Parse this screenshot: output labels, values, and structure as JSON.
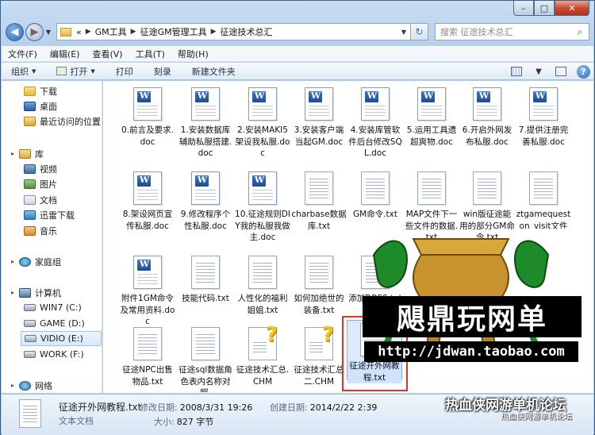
{
  "window": {
    "minimize": "–",
    "maximize": "□",
    "close": "✕"
  },
  "address": {
    "overflow": "«",
    "crumbs": [
      "GM工具",
      "征途GM管理工具",
      "征途技术总汇"
    ],
    "search_placeholder": "搜索 征途技术总汇"
  },
  "menu": [
    "文件(F)",
    "编辑(E)",
    "查看(V)",
    "工具(T)",
    "帮助(H)"
  ],
  "commands": {
    "organize": "组织",
    "open": "打开",
    "print": "打印",
    "burn": "刻录",
    "new_folder": "新建文件夹"
  },
  "nav": {
    "downloads": "下载",
    "desktop": "桌面",
    "recent": "最近访问的位置",
    "library": "库",
    "videos": "视频",
    "pictures": "图片",
    "documents": "文档",
    "thunder": "迅雷下载",
    "music": "音乐",
    "homegroup": "家庭组",
    "computer": "计算机",
    "drive_c": "WIN7 (C:)",
    "drive_d": "GAME (D:)",
    "drive_e": "VIDIO (E:)",
    "drive_f": "WORK (F:)",
    "network": "网络"
  },
  "files": [
    {
      "name": "0.前言及要求.doc",
      "type": "doc"
    },
    {
      "name": "1.安装数据库辅助私服搭建.doc",
      "type": "doc"
    },
    {
      "name": "2.安装MAKI5 架设我私服.doc",
      "type": "doc"
    },
    {
      "name": "3.安装客户端当起GM.doc",
      "type": "doc"
    },
    {
      "name": "4.安装库管软件后台修改SQL.doc",
      "type": "doc"
    },
    {
      "name": "5.运用工具遗超爽物.doc",
      "type": "doc"
    },
    {
      "name": "6.开启外网发布私服.doc",
      "type": "doc"
    },
    {
      "name": "7.提供注册完善私服.doc",
      "type": "doc"
    },
    {
      "name": "8.架设网页宣传私服.doc",
      "type": "doc"
    },
    {
      "name": "9.修改程序个性私服.doc",
      "type": "doc"
    },
    {
      "name": "10.征途规则DIY我的私服我做主.doc",
      "type": "doc"
    },
    {
      "name": "charbase数据库.txt",
      "type": "txt"
    },
    {
      "name": "GM命令.txt",
      "type": "txt"
    },
    {
      "name": "MAP文件下一些文件的数据.txt",
      "type": "txt"
    },
    {
      "name": "win版征途能用的部分GM命令.txt",
      "type": "txt"
    },
    {
      "name": "ztgamequeston_visit文件全部内容一览...",
      "type": "txt"
    },
    {
      "name": "附件1GM命令及常用资料.doc",
      "type": "doc"
    },
    {
      "name": "技能代码.txt",
      "type": "txt"
    },
    {
      "name": "人性化的福利姐姐.txt",
      "type": "txt"
    },
    {
      "name": "如何加绝世的装备.txt",
      "type": "txt"
    },
    {
      "name": "添加BOSS.txt",
      "type": "txt"
    },
    {
      "name": "征途NPC出售物品.txt",
      "type": "txt"
    },
    {
      "name": "征途sql数据角色表内名称对照.",
      "type": "txt"
    },
    {
      "name": "征途技术汇总.CHM",
      "type": "chm"
    },
    {
      "name": "征途技术汇总二.CHM",
      "type": "chm"
    },
    {
      "name": "征途开外网教程.txt",
      "type": "txt"
    }
  ],
  "watermark": {
    "title": "飓鼎玩网单",
    "url": "http://jdwan.taobao.com",
    "forum": "热血侠网游单机论坛",
    "forum_sub": "热血侠网游单机论坛"
  },
  "details": {
    "filename": "征途开外网教程.txt",
    "filetype": "文本文档",
    "modified_label": "修改日期:",
    "modified_value": "2008/3/31 19:26",
    "created_label": "创建日期:",
    "created_value": "2014/2/22 2:39",
    "size_label": "大小:",
    "size_value": "827 字节"
  }
}
